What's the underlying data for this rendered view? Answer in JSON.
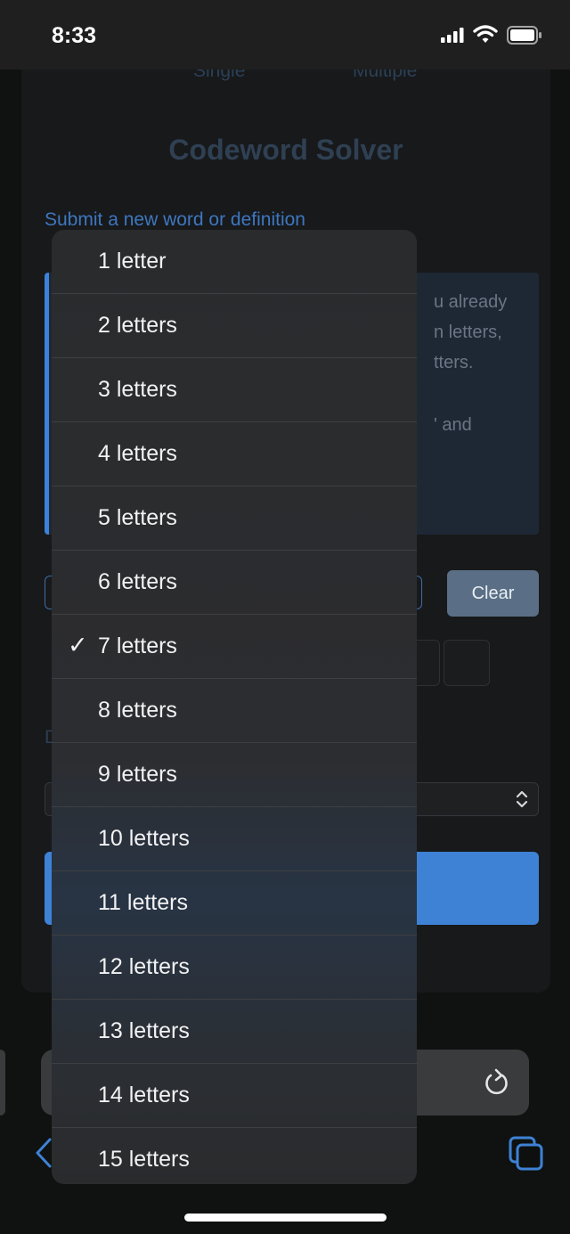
{
  "status_bar": {
    "time": "8:33"
  },
  "page": {
    "tabs": [
      "Single",
      "Multiple"
    ],
    "title": "Codeword Solver",
    "submit_link": "Submit a new word or definition",
    "info_fragments": [
      "u already",
      "n letters,",
      "tters.",
      "' and"
    ],
    "clear_button": "Clear"
  },
  "dropdown": {
    "selected_index": 6,
    "options": [
      "1 letter",
      "2 letters",
      "3 letters",
      "4 letters",
      "5 letters",
      "6 letters",
      "7 letters",
      "8 letters",
      "9 letters",
      "10 letters",
      "11 letters",
      "12 letters",
      "13 letters",
      "14 letters",
      "15 letters"
    ]
  },
  "icons": {
    "signal": "cellular-signal-icon",
    "wifi": "wifi-icon",
    "battery": "battery-icon",
    "reload": "reload-icon",
    "back": "back-icon",
    "tabs": "tabs-icon",
    "check": "checkmark-icon"
  },
  "colors": {
    "accent": "#3d82d5",
    "link": "#3d77bf",
    "background": "#0e100f"
  }
}
